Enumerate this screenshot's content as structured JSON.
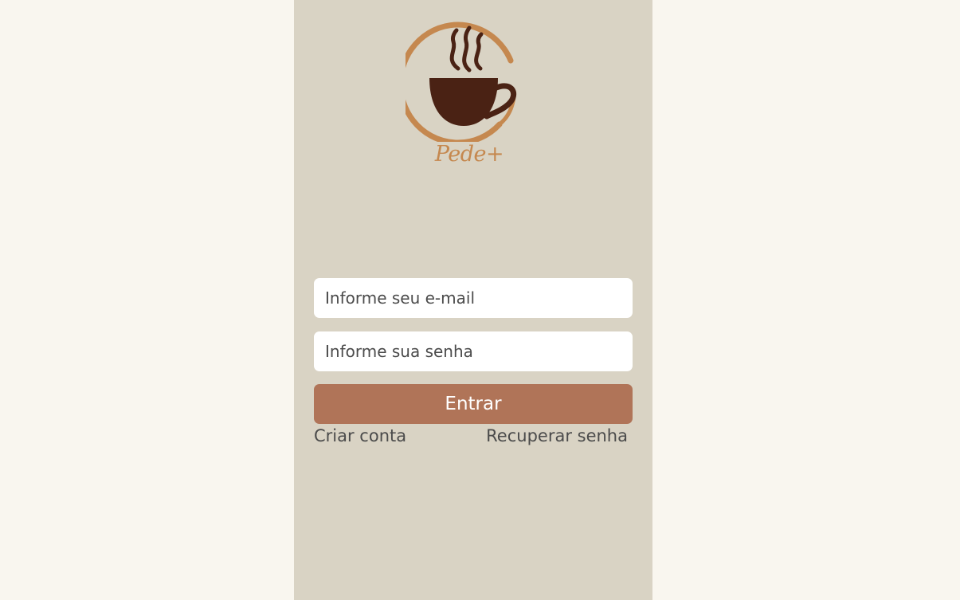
{
  "logo": {
    "text": "Pede+",
    "icon": "coffee-cup-icon",
    "ring_color": "#c5884f",
    "cup_color": "#4a2214"
  },
  "login": {
    "email_placeholder": "Informe seu e-mail",
    "password_placeholder": "Informe sua senha",
    "submit_label": "Entrar",
    "create_account_label": "Criar conta",
    "recover_password_label": "Recuperar senha"
  },
  "colors": {
    "page_background": "#f9f6ef",
    "panel_background": "#d9d3c4",
    "button": "#b07458"
  }
}
